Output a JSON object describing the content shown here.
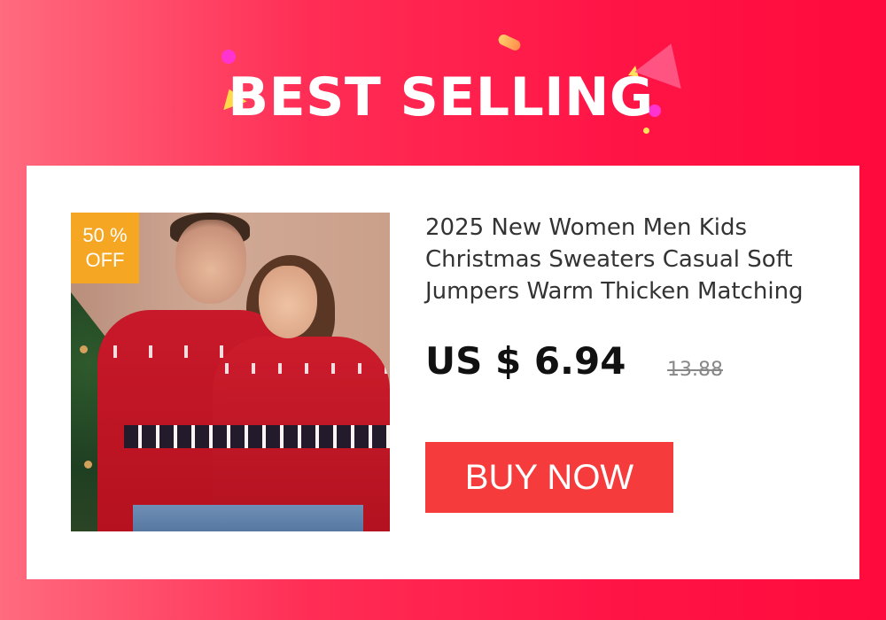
{
  "banner": {
    "title": "BEST SELLING"
  },
  "product": {
    "discount_badge": {
      "percent": "50 %",
      "label": "OFF"
    },
    "title": "2025 New Women Men Kids Christmas Sweaters Casual Soft Jumpers Warm Thicken Matching",
    "price": "US $ 6.94",
    "original_price": "13.88",
    "buy_button_label": "BUY NOW"
  },
  "colors": {
    "background_gradient": [
      "#ff6b7f",
      "#ff0a3c"
    ],
    "card": "#ffffff",
    "buy_button": "#f53b3b",
    "discount_badge": "#f5a623"
  },
  "icons": [
    "confetti-decoration"
  ]
}
